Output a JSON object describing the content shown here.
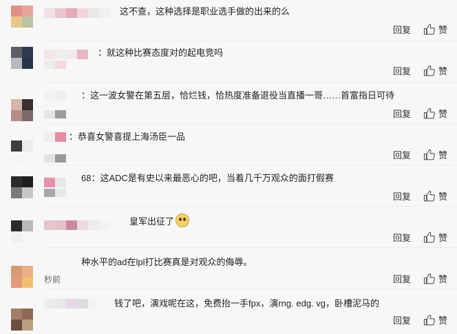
{
  "comments": [
    {
      "text": "这不查，这种选择是职业选手做的出来的么",
      "time": "",
      "reply": "回复",
      "like": "赞"
    },
    {
      "text": "：就这种比赛态度对的起电竞吗",
      "time": "",
      "reply": "回复",
      "like": "赞"
    },
    {
      "text": "：这一波女警在第五层，恰烂钱，恰热度准备退役当直播一哥……首富指日可待",
      "time": "",
      "reply": "回复",
      "like": "赞"
    },
    {
      "text": "：恭喜女警喜提上海汤臣一品",
      "time": "",
      "reply": "回复",
      "like": "赞"
    },
    {
      "text": "68：这ADC是有史以来最恶心的吧，当着几千万观众的面打假赛",
      "time": "",
      "reply": "回复",
      "like": "赞"
    },
    {
      "text": "皇军出征了",
      "time": "",
      "reply": "回复",
      "like": "赞",
      "emoji": "rolling-eyes-emoji"
    },
    {
      "text": "种水平的ad在lpl打比赛真是对观众的侮辱。",
      "time": "秒前",
      "reply": "回复",
      "like": "赞"
    },
    {
      "text": "钱了吧，演戏呢在这，免费抬一手fpx，演rng. edg. vg，卧槽泥马的",
      "time": "",
      "reply": "回复",
      "like": "赞"
    }
  ],
  "icons": {
    "like": "thumbs-up-icon"
  },
  "colors": {
    "background": "#f7f7f7",
    "text": "#222222",
    "muted": "#666666"
  }
}
